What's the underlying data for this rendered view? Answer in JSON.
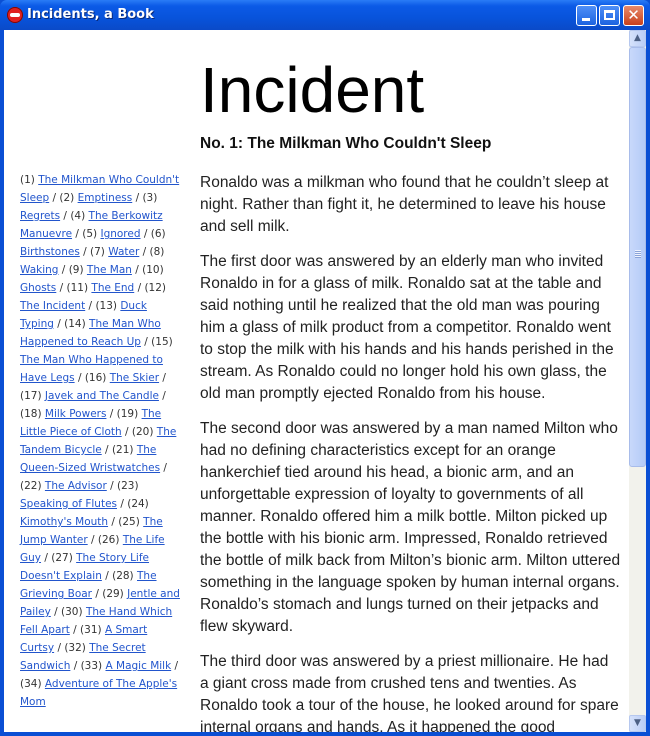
{
  "window": {
    "title": "Incidents, a Book",
    "buttons": {
      "minimize": "_",
      "maximize": "□",
      "close": "✕"
    }
  },
  "scrollbar": {
    "up_arrow": "▲",
    "down_arrow": "▼"
  },
  "page": {
    "title": "Incident",
    "chapter": "No. 1: The Milkman Who Couldn't Sleep"
  },
  "sidebar": {
    "items": [
      {
        "num": "(1) ",
        "title": "The Milkman Who Couldn't Sleep"
      },
      {
        "num": "(2) ",
        "title": "Emptiness"
      },
      {
        "num": "(3) ",
        "title": "Regrets"
      },
      {
        "num": "(4) ",
        "title": "The Berkowitz Manuevre"
      },
      {
        "num": "(5) ",
        "title": "Ignored"
      },
      {
        "num": "(6) ",
        "title": "Birthstones"
      },
      {
        "num": "(7) ",
        "title": "Water"
      },
      {
        "num": "(8) ",
        "title": "Waking"
      },
      {
        "num": "(9) ",
        "title": "The Man"
      },
      {
        "num": "(10) ",
        "title": "Ghosts"
      },
      {
        "num": "(11) ",
        "title": "The End"
      },
      {
        "num": "(12) ",
        "title": "The Incident"
      },
      {
        "num": "(13) ",
        "title": "Duck Typing"
      },
      {
        "num": "(14) ",
        "title": "The Man Who Happened to Reach Up"
      },
      {
        "num": "(15) ",
        "title": "The Man Who Happened to Have Legs"
      },
      {
        "num": "(16) ",
        "title": "The Skier"
      },
      {
        "num": "(17) ",
        "title": "Javek and The Candle"
      },
      {
        "num": "(18) ",
        "title": "Milk Powers"
      },
      {
        "num": "(19) ",
        "title": "The Little Piece of Cloth"
      },
      {
        "num": "(20) ",
        "title": "The Tandem Bicycle"
      },
      {
        "num": "(21) ",
        "title": "The Queen-Sized Wristwatches"
      },
      {
        "num": "(22) ",
        "title": "The Advisor"
      },
      {
        "num": "(23) ",
        "title": "Speaking of Flutes"
      },
      {
        "num": "(24) ",
        "title": "Kimothy's Mouth"
      },
      {
        "num": "(25) ",
        "title": "The Jump Wanter"
      },
      {
        "num": "(26) ",
        "title": "The Life Guy"
      },
      {
        "num": "(27) ",
        "title": "The Story Life Doesn't Explain"
      },
      {
        "num": "(28) ",
        "title": "The Grieving Boar"
      },
      {
        "num": "(29) ",
        "title": "Jentle and Pailey"
      },
      {
        "num": "(30) ",
        "title": "The Hand Which Fell Apart"
      },
      {
        "num": "(31) ",
        "title": "A Smart Curtsy"
      },
      {
        "num": "(32) ",
        "title": "The Secret Sandwich"
      },
      {
        "num": "(33) ",
        "title": "A Magic Milk"
      },
      {
        "num": "(34) ",
        "title": "Adventure of The Apple's Mom"
      }
    ]
  },
  "story": {
    "paragraphs": [
      "Ronaldo was a milkman who found that he couldn’t sleep at night. Rather than fight it, he determined to leave his house and sell milk.",
      "The first door was answered by an elderly man who invited Ronaldo in for a glass of milk. Ronaldo sat at the table and said nothing until he realized that the old man was pouring him a glass of milk product from a competitor. Ronaldo went to stop the milk with his hands and his hands perished in the stream. As Ronaldo could no longer hold his own glass, the old man promptly ejected Ronaldo from his house.",
      "The second door was answered by a man named Milton who had no defining characteristics except for an orange hankerchief tied around his head, a bionic arm, and an unforgettable expression of loyalty to governments of all manner. Ronaldo offered him a milk bottle. Milton picked up the bottle with his bionic arm. Impressed, Ronaldo retrieved the bottle of milk back from Milton’s bionic arm. Milton uttered something in the language spoken by human internal organs. Ronaldo’s stomach and lungs turned on their jetpacks and flew skyward.",
      "The third door was answered by a priest millionaire. He had a giant cross made from crushed tens and twenties. As Ronaldo took a tour of the house, he looked around for spare internal organs and hands. As it happened the good"
    ]
  }
}
